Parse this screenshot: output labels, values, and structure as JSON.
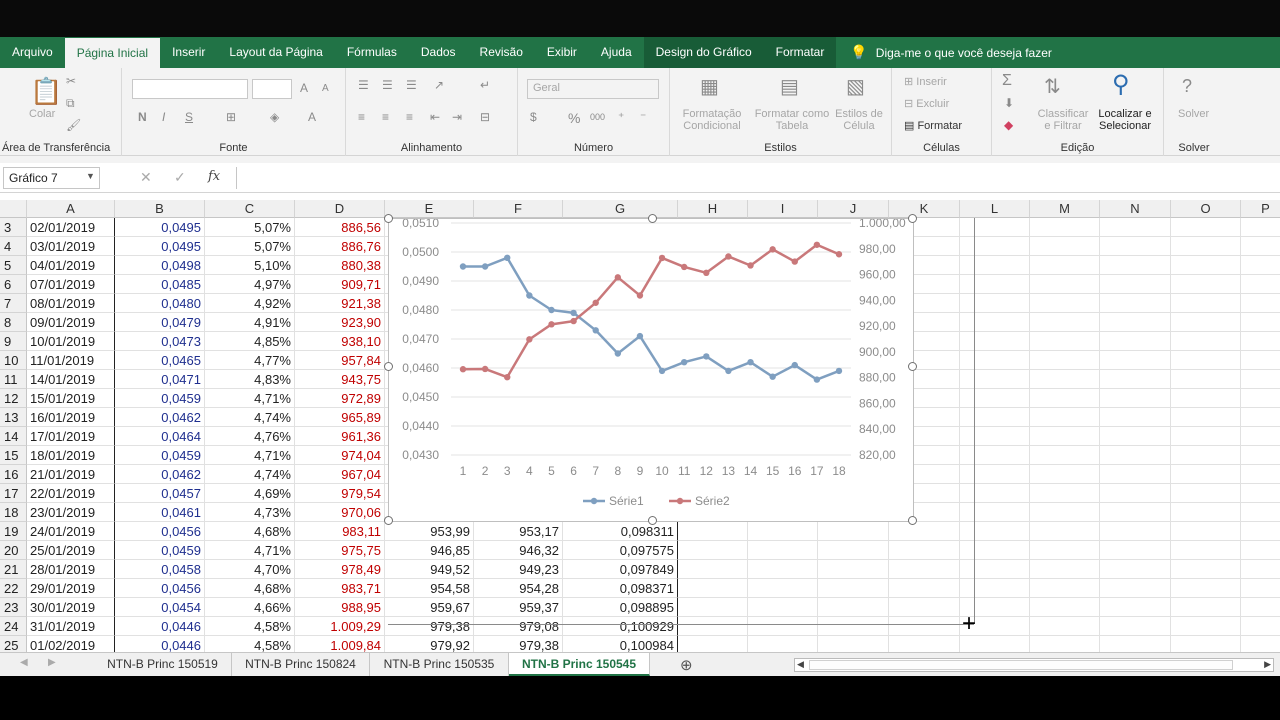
{
  "ribbon_tabs": [
    "Arquivo",
    "Página Inicial",
    "Inserir",
    "Layout da Página",
    "Fórmulas",
    "Dados",
    "Revisão",
    "Exibir",
    "Ajuda",
    "Design do Gráfico",
    "Formatar"
  ],
  "tell_me": "Diga-me o que você deseja fazer",
  "ribbon": {
    "clipboard": {
      "paste": "Colar",
      "label": "Área de Transferência"
    },
    "font": {
      "label": "Fonte",
      "bold": "N",
      "italic": "I",
      "underline": "S",
      "grow": "A",
      "shrink": "A",
      "color": "A"
    },
    "align": {
      "label": "Alinhamento"
    },
    "number": {
      "format": "Geral",
      "percent": "%",
      "thousands": "000",
      "label": "Número"
    },
    "styles": {
      "cond": "Formatação",
      "cond2": "Condicional",
      "table": "Formatar como",
      "table2": "Tabela",
      "cell": "Estilos de",
      "cell2": "Célula",
      "label": "Estilos"
    },
    "cells": {
      "insert": "Inserir",
      "delete": "Excluir",
      "format": "Formatar",
      "label": "Células"
    },
    "edit": {
      "sort": "Classificar",
      "sort2": "e Filtrar",
      "find": "Localizar e",
      "find2": "Selecionar",
      "label": "Edição"
    },
    "solver": {
      "btn": "Solver",
      "label": "Solver"
    }
  },
  "formula_bar": {
    "name_box": "Gráfico 7",
    "fx": "fx",
    "cancel": "✕",
    "enter": "✓"
  },
  "columns": [
    "A",
    "B",
    "C",
    "D",
    "E",
    "F",
    "G",
    "H",
    "I",
    "J",
    "K",
    "L",
    "M",
    "N",
    "O",
    "P"
  ],
  "rows": [
    {
      "n": "3",
      "a": "02/01/2019",
      "b": "0,0495",
      "c": "5,07%",
      "d": "886,56",
      "e": "",
      "f": "",
      "g": ""
    },
    {
      "n": "4",
      "a": "03/01/2019",
      "b": "0,0495",
      "c": "5,07%",
      "d": "886,76",
      "e": "",
      "f": "",
      "g": ""
    },
    {
      "n": "5",
      "a": "04/01/2019",
      "b": "0,0498",
      "c": "5,10%",
      "d": "880,38",
      "e": "",
      "f": "",
      "g": ""
    },
    {
      "n": "6",
      "a": "07/01/2019",
      "b": "0,0485",
      "c": "4,97%",
      "d": "909,71",
      "e": "",
      "f": "",
      "g": ""
    },
    {
      "n": "7",
      "a": "08/01/2019",
      "b": "0,0480",
      "c": "4,92%",
      "d": "921,38",
      "e": "",
      "f": "",
      "g": ""
    },
    {
      "n": "8",
      "a": "09/01/2019",
      "b": "0,0479",
      "c": "4,91%",
      "d": "923,90",
      "e": "",
      "f": "",
      "g": ""
    },
    {
      "n": "9",
      "a": "10/01/2019",
      "b": "0,0473",
      "c": "4,85%",
      "d": "938,10",
      "e": "",
      "f": "",
      "g": ""
    },
    {
      "n": "10",
      "a": "11/01/2019",
      "b": "0,0465",
      "c": "4,77%",
      "d": "957,84",
      "e": "",
      "f": "",
      "g": ""
    },
    {
      "n": "11",
      "a": "14/01/2019",
      "b": "0,0471",
      "c": "4,83%",
      "d": "943,75",
      "e": "",
      "f": "",
      "g": ""
    },
    {
      "n": "12",
      "a": "15/01/2019",
      "b": "0,0459",
      "c": "4,71%",
      "d": "972,89",
      "e": "",
      "f": "",
      "g": ""
    },
    {
      "n": "13",
      "a": "16/01/2019",
      "b": "0,0462",
      "c": "4,74%",
      "d": "965,89",
      "e": "",
      "f": "",
      "g": ""
    },
    {
      "n": "14",
      "a": "17/01/2019",
      "b": "0,0464",
      "c": "4,76%",
      "d": "961,36",
      "e": "",
      "f": "",
      "g": ""
    },
    {
      "n": "15",
      "a": "18/01/2019",
      "b": "0,0459",
      "c": "4,71%",
      "d": "974,04",
      "e": "",
      "f": "",
      "g": ""
    },
    {
      "n": "16",
      "a": "21/01/2019",
      "b": "0,0462",
      "c": "4,74%",
      "d": "967,04",
      "e": "",
      "f": "",
      "g": ""
    },
    {
      "n": "17",
      "a": "22/01/2019",
      "b": "0,0457",
      "c": "4,69%",
      "d": "979,54",
      "e": "",
      "f": "",
      "g": ""
    },
    {
      "n": "18",
      "a": "23/01/2019",
      "b": "0,0461",
      "c": "4,73%",
      "d": "970,06",
      "e": "",
      "f": "",
      "g": ""
    },
    {
      "n": "19",
      "a": "24/01/2019",
      "b": "0,0456",
      "c": "4,68%",
      "d": "983,11",
      "e": "953,99",
      "f": "953,17",
      "g": "0,098311"
    },
    {
      "n": "20",
      "a": "25/01/2019",
      "b": "0,0459",
      "c": "4,71%",
      "d": "975,75",
      "e": "946,85",
      "f": "946,32",
      "g": "0,097575"
    },
    {
      "n": "21",
      "a": "28/01/2019",
      "b": "0,0458",
      "c": "4,70%",
      "d": "978,49",
      "e": "949,52",
      "f": "949,23",
      "g": "0,097849"
    },
    {
      "n": "22",
      "a": "29/01/2019",
      "b": "0,0456",
      "c": "4,68%",
      "d": "983,71",
      "e": "954,58",
      "f": "954,28",
      "g": "0,098371"
    },
    {
      "n": "23",
      "a": "30/01/2019",
      "b": "0,0454",
      "c": "4,66%",
      "d": "988,95",
      "e": "959,67",
      "f": "959,37",
      "g": "0,098895"
    },
    {
      "n": "24",
      "a": "31/01/2019",
      "b": "0,0446",
      "c": "4,58%",
      "d": "1.009,29",
      "e": "979,38",
      "f": "979,08",
      "g": "0,100929"
    },
    {
      "n": "25",
      "a": "01/02/2019",
      "b": "0,0446",
      "c": "4,58%",
      "d": "1.009,84",
      "e": "979,92",
      "f": "979,38",
      "g": "0,100984"
    }
  ],
  "sheet_tabs": [
    "NTN-B Princ 150519",
    "NTN-B Princ 150824",
    "NTN-B Princ 150535",
    "NTN-B Princ 150545"
  ],
  "colors": {
    "excel_green": "#217346",
    "serie1": "#7f9fc0",
    "serie2": "#c9787a",
    "col_b": "#1f2f8f",
    "col_d": "#c00000"
  },
  "chart_data": {
    "type": "line",
    "x": [
      1,
      2,
      3,
      4,
      5,
      6,
      7,
      8,
      9,
      10,
      11,
      12,
      13,
      14,
      15,
      16,
      17,
      18
    ],
    "series": [
      {
        "name": "Série1",
        "axis": "left",
        "values": [
          0.0495,
          0.0495,
          0.0498,
          0.0485,
          0.048,
          0.0479,
          0.0473,
          0.0465,
          0.0471,
          0.0459,
          0.0462,
          0.0464,
          0.0459,
          0.0462,
          0.0457,
          0.0461,
          0.0456,
          0.0459
        ]
      },
      {
        "name": "Série2",
        "axis": "right",
        "values": [
          886.56,
          886.76,
          880.38,
          909.71,
          921.38,
          923.9,
          938.1,
          957.84,
          943.75,
          972.89,
          965.89,
          961.36,
          974.04,
          967.04,
          979.54,
          970.06,
          983.11,
          975.75
        ]
      }
    ],
    "y_left_ticks": [
      "0,0430",
      "0,0440",
      "0,0450",
      "0,0460",
      "0,0470",
      "0,0480",
      "0,0490",
      "0,0500",
      "0,0510"
    ],
    "y_right_ticks": [
      "820,00",
      "840,00",
      "860,00",
      "880,00",
      "900,00",
      "920,00",
      "940,00",
      "960,00",
      "980,00",
      "1.000,00"
    ],
    "ylim_left": [
      0.043,
      0.051
    ],
    "ylim_right": [
      820,
      1000
    ],
    "legend": "bottom",
    "grid": true
  }
}
